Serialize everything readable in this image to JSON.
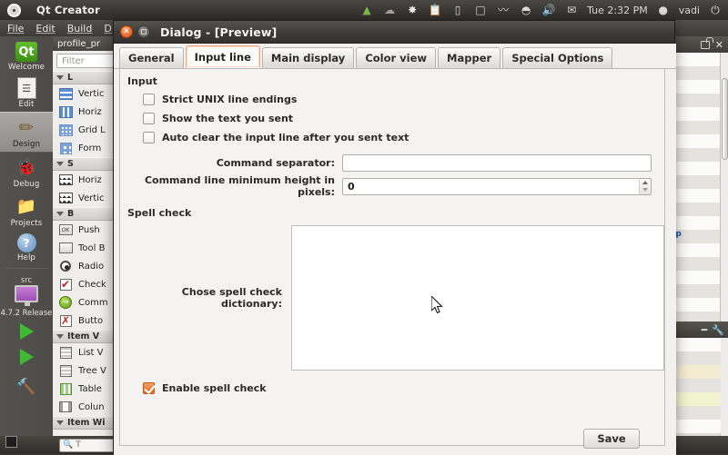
{
  "ubuntu_panel": {
    "logo_icon": "ubuntu-logo-icon",
    "app_title": "Qt Creator",
    "tray": [
      {
        "name": "dropbox-icon",
        "glyph": "▲"
      },
      {
        "name": "cloud-sync-icon",
        "glyph": "☁"
      },
      {
        "name": "package-icon",
        "glyph": "✸"
      },
      {
        "name": "clipboard-icon",
        "glyph": "ὌB"
      },
      {
        "name": "battery-icon",
        "glyph": "▭"
      },
      {
        "name": "display-icon",
        "glyph": "□"
      },
      {
        "name": "system-monitor-icon",
        "glyph": "〰"
      },
      {
        "name": "wifi-icon",
        "glyph": "◠"
      },
      {
        "name": "volume-icon",
        "glyph": "ὐA"
      },
      {
        "name": "mail-icon",
        "glyph": "✉"
      }
    ],
    "clock": "Tue 2:32 PM",
    "user_icon": "user-avatar-icon",
    "username": "vadi",
    "power_icon": "power-icon",
    "power_glyph": "⏻"
  },
  "qt_creator": {
    "menus": [
      "File",
      "Edit",
      "Build",
      "D"
    ],
    "modes": [
      {
        "label": "Welcome",
        "icon": "qt-logo-icon",
        "glyph": "Qt",
        "active": false
      },
      {
        "label": "Edit",
        "icon": "edit-document-icon",
        "glyph": "὜E",
        "active": false
      },
      {
        "label": "Design",
        "icon": "design-brush-icon",
        "glyph": "✎",
        "active": true
      },
      {
        "label": "Debug",
        "icon": "debug-bug-icon",
        "glyph": "ὁE",
        "active": false
      },
      {
        "label": "Projects",
        "icon": "projects-folder-icon",
        "glyph": "Ὄ1",
        "active": false
      },
      {
        "label": "Help",
        "icon": "help-question-icon",
        "glyph": "?",
        "active": false
      }
    ],
    "kit": {
      "project_name": "src",
      "target_icon": "target-desktop-icon",
      "release_label": "4.7.2 Release",
      "run_icon": "run-play-icon",
      "debug_run_icon": "debug-run-icon"
    },
    "widget_box": {
      "editor_tab_label": "profile_pr",
      "filter_placeholder": "Filter",
      "groups": [
        {
          "title": "L",
          "items": [
            {
              "label": "Vertic",
              "icon": "vertical-layout-icon",
              "cls": "i-vlayout"
            },
            {
              "label": "Horiz",
              "icon": "horizontal-layout-icon",
              "cls": "i-hlayout"
            },
            {
              "label": "Grid L",
              "icon": "grid-layout-icon",
              "cls": "i-grid"
            },
            {
              "label": "Form",
              "icon": "form-layout-icon",
              "cls": "i-form"
            }
          ]
        },
        {
          "title": "S",
          "items": [
            {
              "label": "Horiz",
              "icon": "horizontal-spacer-icon",
              "cls": "i-spacerh"
            },
            {
              "label": "Vertic",
              "icon": "vertical-spacer-icon",
              "cls": "i-spacerh"
            }
          ]
        },
        {
          "title": "B",
          "items": [
            {
              "label": "Push",
              "icon": "push-button-icon",
              "cls": "i-push",
              "text": "OK"
            },
            {
              "label": "Tool B",
              "icon": "tool-button-icon",
              "cls": "i-push",
              "text": ""
            },
            {
              "label": "Radio",
              "icon": "radio-button-icon",
              "cls": "i-radio"
            },
            {
              "label": "Check",
              "icon": "check-box-icon",
              "cls": "i-check",
              "text": "✔"
            },
            {
              "label": "Comm",
              "icon": "command-link-button-icon",
              "cls": "i-green",
              "text": "→"
            },
            {
              "label": "Butto",
              "icon": "button-box-icon",
              "cls": "i-check",
              "text": "✗"
            }
          ]
        },
        {
          "title": "Item V",
          "items": [
            {
              "label": "List V",
              "icon": "list-view-icon",
              "cls": "i-listv"
            },
            {
              "label": "Tree V",
              "icon": "tree-view-icon",
              "cls": "i-listv"
            },
            {
              "label": "Table",
              "icon": "table-view-icon",
              "cls": "i-tablev"
            },
            {
              "label": "Colun",
              "icon": "column-view-icon",
              "cls": "i-colv"
            }
          ]
        },
        {
          "title": "Item Wi",
          "items": []
        }
      ]
    },
    "right_dock": {
      "lock_icon": "lock-icon",
      "close_icon": "close-icon",
      "close_glyph": "✕",
      "property_value": "cp",
      "minimize_icon": "minimize-icon",
      "tools_icon": "wrench-icon"
    },
    "status_bar": {
      "toggle_icon": "sidebar-toggle-icon",
      "search_icon": "search-icon",
      "search_placeholder": "T"
    }
  },
  "dialog": {
    "title": "Dialog - [Preview]",
    "close_icon": "close-icon",
    "close_glyph": "✕",
    "maximize_icon": "maximize-icon",
    "tabs": [
      {
        "label": "General",
        "selected": false
      },
      {
        "label": "Input line",
        "selected": true
      },
      {
        "label": "Main display",
        "selected": false
      },
      {
        "label": "Color view",
        "selected": false
      },
      {
        "label": "Mapper",
        "selected": false
      },
      {
        "label": "Special Options",
        "selected": false
      }
    ],
    "input_group": {
      "title": "Input",
      "checkboxes": [
        {
          "label": "Strict UNIX line endings",
          "checked": false
        },
        {
          "label": "Show the text you sent",
          "checked": false
        },
        {
          "label": "Auto clear the input line after you sent text",
          "checked": false
        }
      ],
      "command_separator": {
        "label": "Command separator:",
        "value": ""
      },
      "command_min_height": {
        "label": "Command line minimum height in pixels:",
        "value": "0"
      }
    },
    "spell_check_group": {
      "title": "Spell check",
      "dictionary_label": "Chose spell check dictionary:",
      "dictionary_items": [],
      "enable": {
        "label": "Enable spell check",
        "checked": true
      }
    },
    "save_button": "Save",
    "accent_color": "#e2691f",
    "tab_highlight_color": "#f0a780"
  }
}
